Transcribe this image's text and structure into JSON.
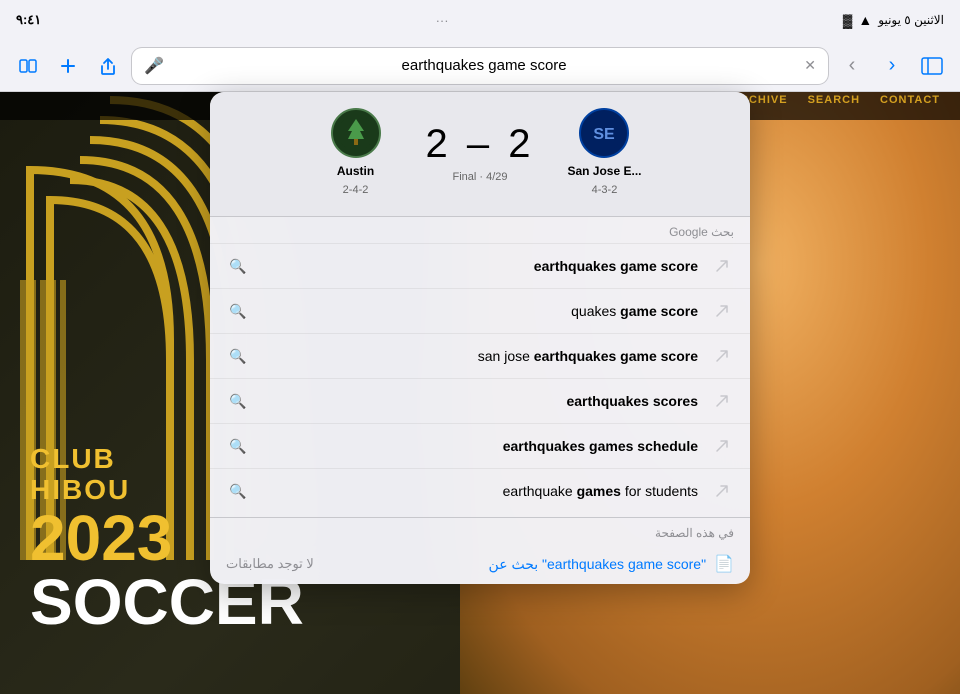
{
  "status_bar": {
    "time": "٩:٤١",
    "date": "الاثنين ٥ يونيو",
    "wifi_icon": "wifi",
    "battery_icon": "battery",
    "dots": "···"
  },
  "browser": {
    "search_query": "earthquakes game score",
    "back_btn": "‹",
    "forward_btn": "›",
    "tabs_btn": "⊞",
    "share_btn": "↑",
    "new_tab_btn": "+",
    "tabs_view_btn": "⊡",
    "mic_btn": "🎤",
    "clear_btn": "✕"
  },
  "website": {
    "nav_items": [
      "ARCHIVE",
      "SEARCH",
      "CONTACT"
    ],
    "club_line1": "CLUB",
    "club_line2": "HIBOU",
    "year": "2023",
    "soccer": "SOCCER"
  },
  "score_card": {
    "team1_name": "Austin",
    "team1_record": "2-4-2",
    "team2_name": "San Jose E...",
    "team2_record": "4-3-2",
    "score": "2 – 2",
    "match_status": "Final · 4/29"
  },
  "google_section": {
    "label": "بحث Google"
  },
  "suggestions": [
    {
      "text_normal": "",
      "text_bold": "earthquakes game score"
    },
    {
      "text_normal": "quakes ",
      "text_bold": "game score"
    },
    {
      "text_normal": "san jose ",
      "text_bold": "earthquakes game score"
    },
    {
      "text_normal": "",
      "text_bold": "earthquakes scores"
    },
    {
      "text_normal": "",
      "text_bold": "earthquakes games schedule"
    },
    {
      "text_normal": "earthquake ",
      "text_bold": "games",
      "text_suffix": " for students"
    }
  ],
  "on_page_section": {
    "header": "في هذه الصفحة",
    "no_matches": "لا توجد مطابقات",
    "search_label": "\"earthquakes game score\" بحث عن"
  }
}
